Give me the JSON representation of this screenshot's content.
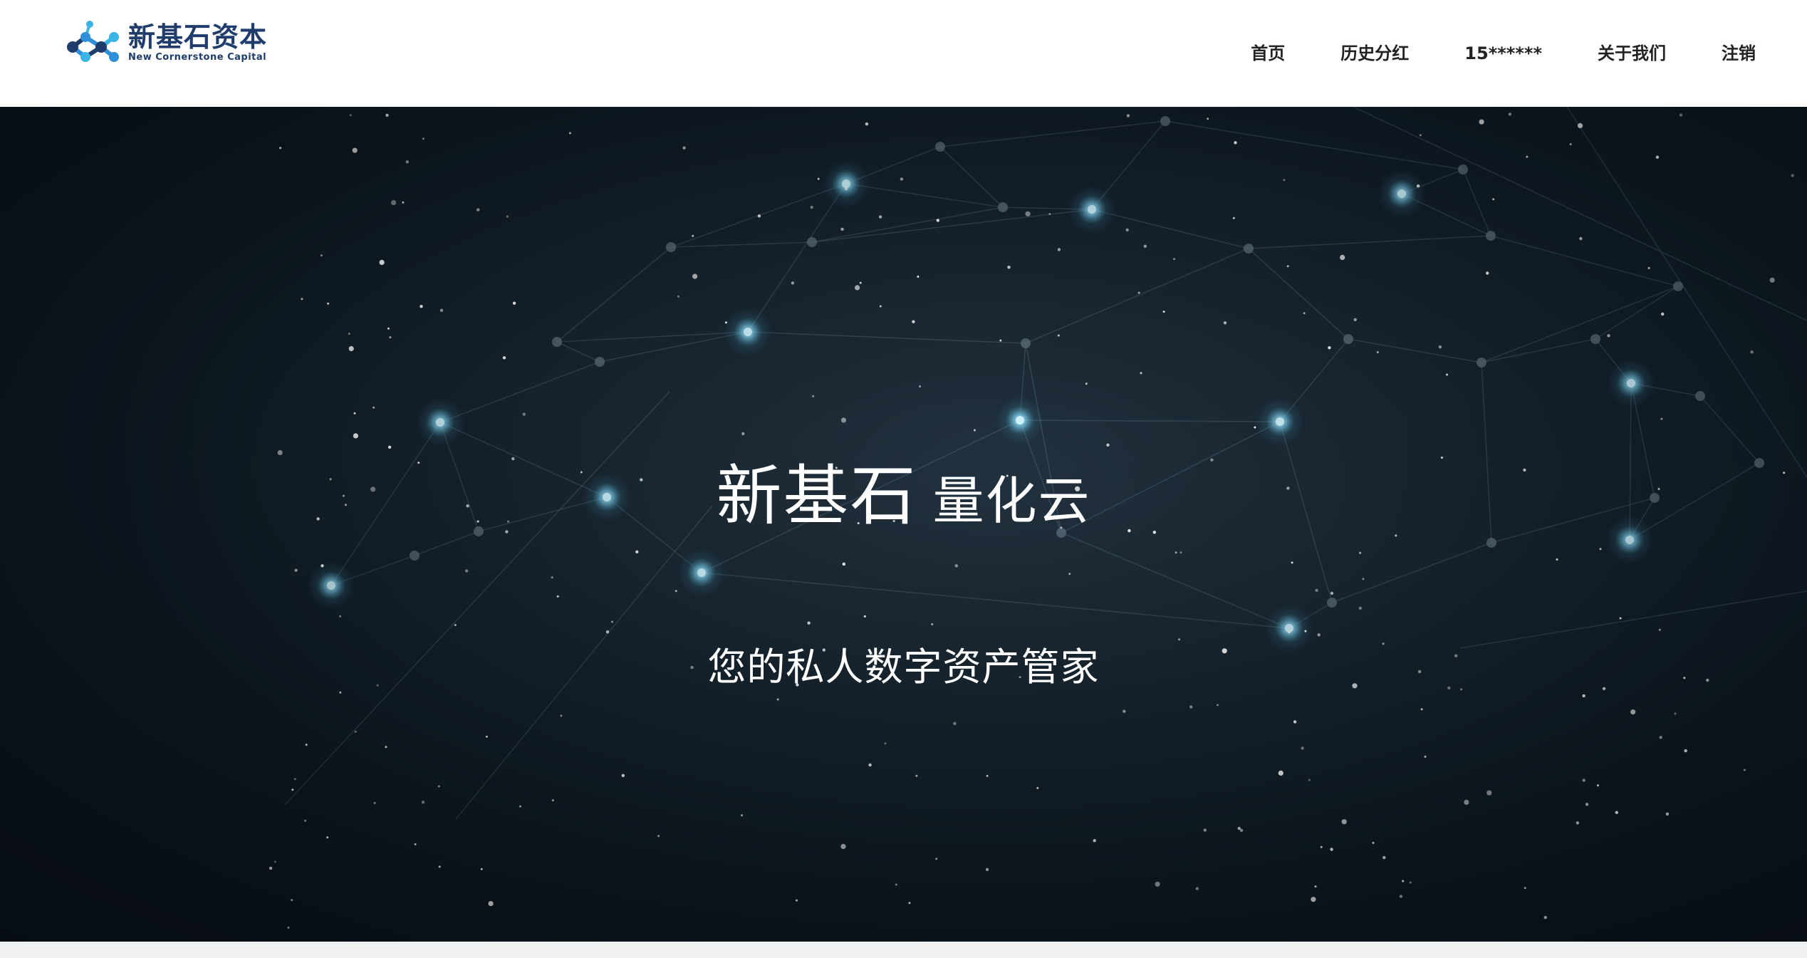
{
  "header": {
    "logo": {
      "cn": "新基石资本",
      "en": "New Cornerstone Capital",
      "icon": "molecule-logo-icon",
      "colors": {
        "primary": "#1f3c6b",
        "accent_blue": "#2f8fd8",
        "accent_light": "#3bb4e6"
      }
    },
    "nav": [
      {
        "label": "首页"
      },
      {
        "label": "历史分红"
      },
      {
        "label": "15******"
      },
      {
        "label": "关于我们"
      },
      {
        "label": "注销"
      }
    ]
  },
  "hero": {
    "title_main": "新基石",
    "title_sub": "量化云",
    "subtitle": "您的私人数字资产管家",
    "background": "starfield-network-globe",
    "colors": {
      "bg_dark": "#0a141d",
      "bg_mid": "#182631",
      "glow": "#7fd3f0",
      "text": "#ffffff"
    }
  }
}
